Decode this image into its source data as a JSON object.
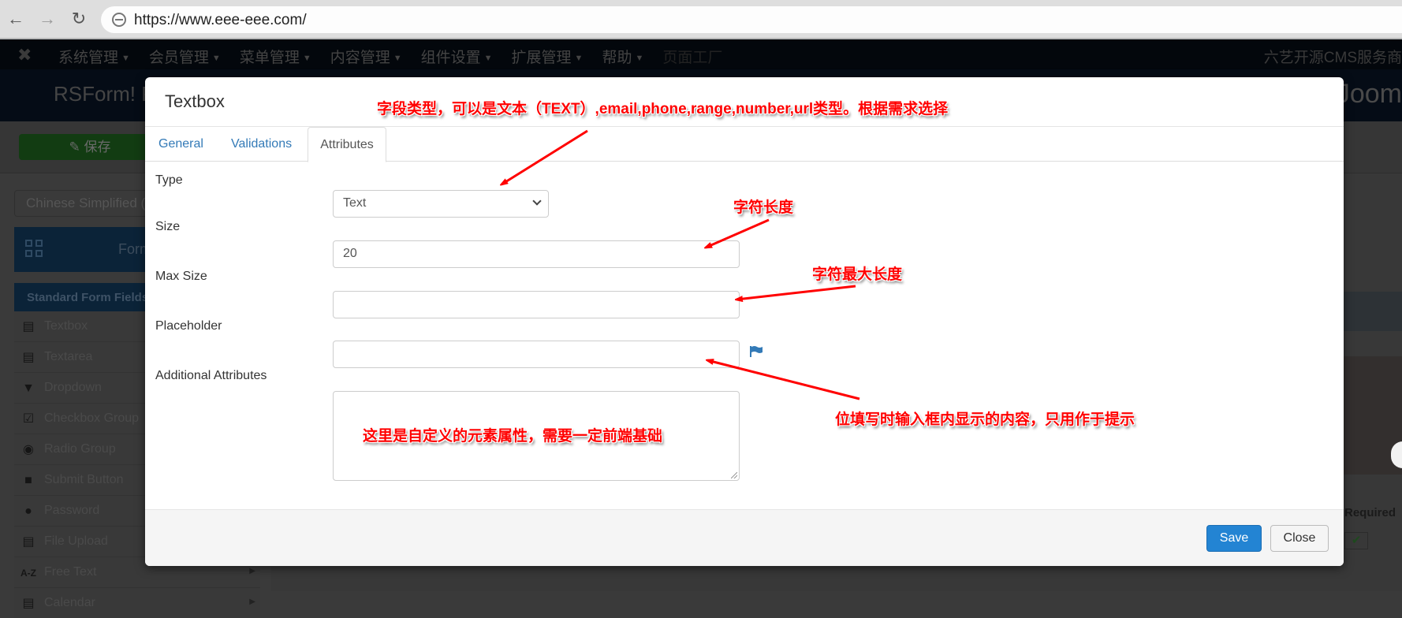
{
  "browser": {
    "url": "https://www.eee-eee.com/",
    "back_icon": "arrow-left-icon",
    "forward_icon": "arrow-right-icon",
    "reload_icon": "reload-icon"
  },
  "topnav": {
    "logo_icon": "joomla-logo-icon",
    "menu": [
      {
        "label": "系统管理"
      },
      {
        "label": "会员管理"
      },
      {
        "label": "菜单管理"
      },
      {
        "label": "内容管理"
      },
      {
        "label": "组件设置"
      },
      {
        "label": "扩展管理"
      },
      {
        "label": "帮助"
      }
    ],
    "page_factory": "页面工厂",
    "brand": "六艺开源CMS服务商"
  },
  "header": {
    "title": "RSForm! P",
    "joomla_text": "Joom"
  },
  "toolbar": {
    "save_label": "保存",
    "save_icon": "edit-icon"
  },
  "sidebar": {
    "language": "Chinese Simplified (z",
    "forms_label": "Form",
    "fields_header": "Standard Form Fields",
    "fields": [
      {
        "label": "Textbox",
        "icon": "textbox-icon"
      },
      {
        "label": "Textarea",
        "icon": "textarea-icon"
      },
      {
        "label": "Dropdown",
        "icon": "dropdown-icon"
      },
      {
        "label": "Checkbox Group",
        "icon": "checkbox-icon"
      },
      {
        "label": "Radio Group",
        "icon": "radio-icon"
      },
      {
        "label": "Submit Button",
        "icon": "submit-icon"
      },
      {
        "label": "Password",
        "icon": "lock-icon"
      },
      {
        "label": "File Upload",
        "icon": "file-icon"
      },
      {
        "label": "Free Text",
        "icon": "az-icon"
      },
      {
        "label": "Calendar",
        "icon": "calendar-icon"
      }
    ]
  },
  "background_table": {
    "required_label": "Required"
  },
  "modal": {
    "title": "Textbox",
    "tabs": [
      {
        "label": "General",
        "active": false
      },
      {
        "label": "Validations",
        "active": false
      },
      {
        "label": "Attributes",
        "active": true
      }
    ],
    "fields": {
      "type": {
        "label": "Type",
        "value": "Text"
      },
      "size": {
        "label": "Size",
        "value": "20"
      },
      "max_size": {
        "label": "Max Size",
        "value": ""
      },
      "placeholder": {
        "label": "Placeholder",
        "value": ""
      },
      "additional_attributes": {
        "label": "Additional Attributes",
        "value": ""
      }
    },
    "footer": {
      "save_label": "Save",
      "close_label": "Close"
    }
  },
  "annotations": {
    "type_note": "字段类型，可以是文本（TEXT）,email,phone,range,number,url类型。根据需求选择",
    "size_note": "字符长度",
    "max_size_note": "字符最大长度",
    "placeholder_note": "位填写时输入框内显示的内容，只用作于提示",
    "attributes_note": "这里是自定义的元素属性，需要一定前端基础",
    "color": "#ff0000"
  }
}
